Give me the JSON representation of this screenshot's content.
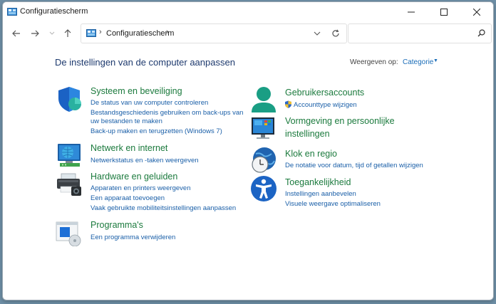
{
  "window": {
    "title": "Configuratiescherm"
  },
  "address": {
    "path": "Configuratiescherm"
  },
  "search": {
    "placeholder": ""
  },
  "header": {
    "title": "De instellingen van de computer aanpassen",
    "view_label": "Weergeven op:",
    "view_value": "Categorie"
  },
  "left": [
    {
      "heading": "Systeem en beveiliging",
      "icon": "shield-icon",
      "links": [
        "De status van uw computer controleren",
        "Bestandsgeschiedenis gebruiken om back-ups van",
        "uw bestanden te maken",
        "Back-up maken en terugzetten (Windows 7)"
      ]
    },
    {
      "heading": "Netwerk en internet",
      "icon": "network-icon",
      "links": [
        "Netwerkstatus en -taken weergeven"
      ]
    },
    {
      "heading": "Hardware en geluiden",
      "icon": "printer-icon",
      "links": [
        "Apparaten en printers weergeven",
        "Een apparaat toevoegen",
        "Vaak gebruikte mobiliteitsinstellingen aanpassen"
      ]
    },
    {
      "heading": "Programma's",
      "icon": "programs-icon",
      "links": [
        "Een programma verwijderen"
      ]
    }
  ],
  "right": [
    {
      "heading": "Gebruikersaccounts",
      "icon": "user-icon",
      "links": [
        "Accounttype wijzigen"
      ]
    },
    {
      "heading": "Vormgeving en persoonlijke",
      "heading2": "instellingen",
      "icon": "appearance-icon",
      "links": []
    },
    {
      "heading": "Klok en regio",
      "icon": "clock-icon",
      "links": [
        "De notatie voor datum, tijd of getallen wijzigen"
      ]
    },
    {
      "heading": "Toegankelijkheid",
      "icon": "accessibility-icon",
      "links": [
        "Instellingen aanbevelen",
        "Visuele weergave optimaliseren"
      ]
    }
  ],
  "colors": {
    "heading": "#1b7a3d",
    "link": "#1a5fa8",
    "title": "#1e3a6e"
  }
}
